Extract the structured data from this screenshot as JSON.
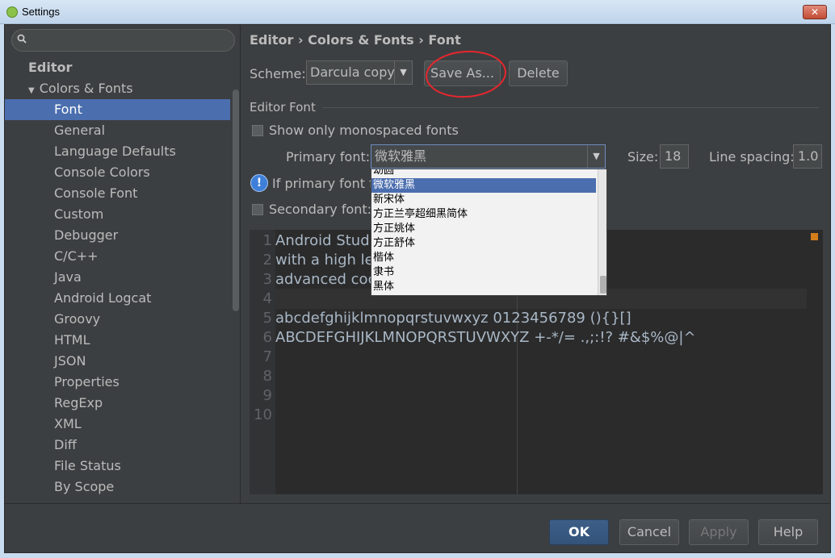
{
  "window": {
    "title": "Settings",
    "close_glyph": "✕"
  },
  "search": {
    "placeholder": ""
  },
  "sidebar": {
    "items": [
      {
        "label": "Editor",
        "level": 0
      },
      {
        "label": "Colors & Fonts",
        "level": 1,
        "expanded": true
      },
      {
        "label": "Font",
        "level": 2,
        "selected": true
      },
      {
        "label": "General",
        "level": 2
      },
      {
        "label": "Language Defaults",
        "level": 2
      },
      {
        "label": "Console Colors",
        "level": 2
      },
      {
        "label": "Console Font",
        "level": 2
      },
      {
        "label": "Custom",
        "level": 2
      },
      {
        "label": "Debugger",
        "level": 2
      },
      {
        "label": "C/C++",
        "level": 2
      },
      {
        "label": "Java",
        "level": 2
      },
      {
        "label": "Android Logcat",
        "level": 2
      },
      {
        "label": "Groovy",
        "level": 2
      },
      {
        "label": "HTML",
        "level": 2
      },
      {
        "label": "JSON",
        "level": 2
      },
      {
        "label": "Properties",
        "level": 2
      },
      {
        "label": "RegExp",
        "level": 2
      },
      {
        "label": "XML",
        "level": 2
      },
      {
        "label": "Diff",
        "level": 2
      },
      {
        "label": "File Status",
        "level": 2
      },
      {
        "label": "By Scope",
        "level": 2
      }
    ]
  },
  "header": {
    "breadcrumb": "Editor › Colors & Fonts › Font"
  },
  "scheme": {
    "label": "Scheme:",
    "value": "Darcula copy",
    "save_as": "Save As...",
    "delete": "Delete"
  },
  "editor_font": {
    "section_title": "Editor Font",
    "monospaced_label": "Show only monospaced fonts",
    "primary_label": "Primary font:",
    "primary_value": "微软雅黑",
    "size_label": "Size:",
    "size_value": "18",
    "line_spacing_label": "Line spacing:",
    "line_spacing_value": "1.0",
    "info_text": "If primary font f",
    "secondary_label": "Secondary font:"
  },
  "font_dropdown": {
    "items": [
      "幼圆",
      "微软雅黑",
      "新宋体",
      "方正兰亭超细黑简体",
      "方正姚体",
      "方正舒体",
      "楷体",
      "隶书",
      "黑体"
    ],
    "selected_index": 1
  },
  "preview": {
    "line_numbers": [
      "1",
      "2",
      "3",
      "4",
      "5",
      "6",
      "7",
      "8",
      "9",
      "10"
    ],
    "lines": [
      "Android Stud",
      "with a high le",
      "advanced coc",
      "",
      "abcdefghijklmnopqrstuvwxyz 0123456789 (){}[]",
      "ABCDEFGHIJKLMNOPQRSTUVWXYZ +-*/= .,;:!? #&$%@|^",
      "",
      "",
      "",
      ""
    ]
  },
  "footer": {
    "ok": "OK",
    "cancel": "Cancel",
    "apply": "Apply",
    "help": "Help"
  },
  "colors": {
    "selection": "#4b6eaf",
    "panel": "#3c3f41",
    "editor_bg": "#2b2b2b",
    "annotation": "#e8262e"
  }
}
